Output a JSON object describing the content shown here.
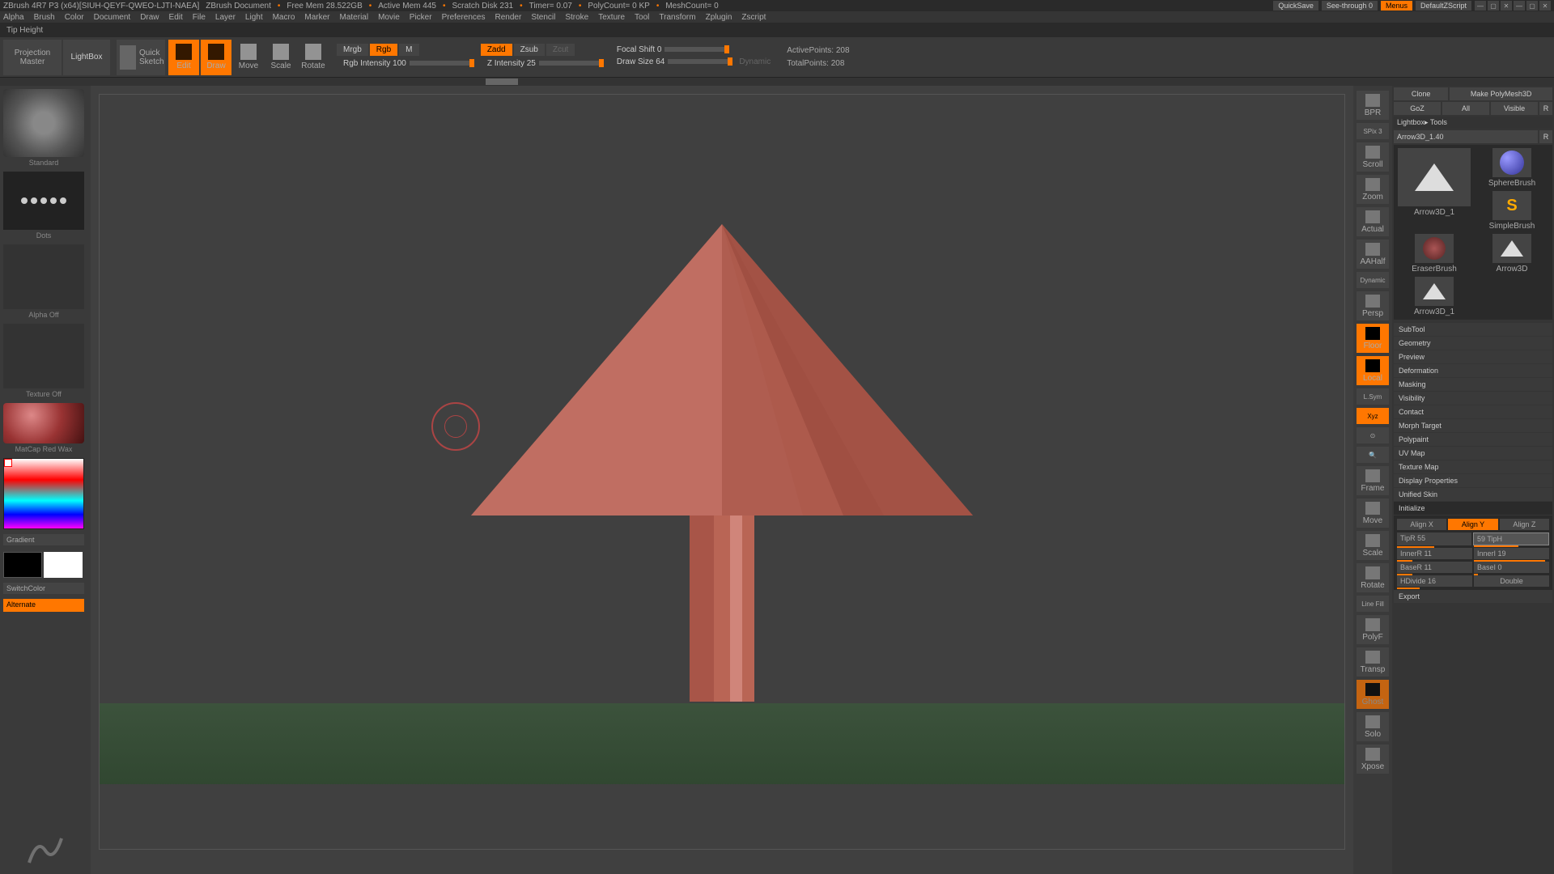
{
  "titlebar": {
    "app": "ZBrush 4R7 P3 (x64)[SIUH-QEYF-QWEO-LJTI-NAEA]",
    "doc": "ZBrush Document",
    "freemem": "Free Mem 28.522GB",
    "activemem": "Active Mem 445",
    "scratch": "Scratch Disk 231",
    "timer": "Timer= 0.07",
    "polycount": "PolyCount= 0 KP",
    "meshcount": "MeshCount= 0",
    "quicksave": "QuickSave",
    "seethrough": "See-through  0",
    "menus": "Menus",
    "script": "DefaultZScript"
  },
  "menu": [
    "Alpha",
    "Brush",
    "Color",
    "Document",
    "Draw",
    "Edit",
    "File",
    "Layer",
    "Light",
    "Macro",
    "Marker",
    "Material",
    "Movie",
    "Picker",
    "Preferences",
    "Render",
    "Stencil",
    "Stroke",
    "Texture",
    "Tool",
    "Transform",
    "Zplugin",
    "Zscript"
  ],
  "statusline": "Tip Height",
  "toolbar": {
    "projmaster1": "Projection",
    "projmaster2": "Master",
    "lightbox": "LightBox",
    "quick": "Quick",
    "sketch": "Sketch",
    "edit": "Edit",
    "draw": "Draw",
    "move": "Move",
    "scale": "Scale",
    "rotate": "Rotate",
    "mrgb": "Mrgb",
    "rgb": "Rgb",
    "m": "M",
    "rgbint": "Rgb Intensity 100",
    "zadd": "Zadd",
    "zsub": "Zsub",
    "zcut": "Zcut",
    "zint": "Z Intensity 25",
    "focal": "Focal Shift 0",
    "drawsize": "Draw Size 64",
    "dynamic": "Dynamic",
    "active": "ActivePoints: 208",
    "total": "TotalPoints: 208"
  },
  "left": {
    "brush": "Standard",
    "stroke": "Dots",
    "alpha": "Alpha Off",
    "texture": "Texture Off",
    "material": "MatCap Red Wax",
    "gradient": "Gradient",
    "switch": "SwitchColor",
    "alternate": "Alternate"
  },
  "rside": {
    "bpr": "BPR",
    "spix": "SPix 3",
    "scroll": "Scroll",
    "zoom": "Zoom",
    "actual": "Actual",
    "aahalf": "AAHalf",
    "persp": "Persp",
    "floor": "Floor",
    "local": "Local",
    "lsym": "L.Sym",
    "xyz": "Xyz",
    "frame": "Frame",
    "move": "Move",
    "scale": "Scale",
    "rotate": "Rotate",
    "linefill": "Line Fill",
    "polyf": "PolyF",
    "transp": "Transp",
    "ghost": "Ghost",
    "solo": "Solo",
    "xpose": "Xpose",
    "dynamic": "Dynamic"
  },
  "rpanel": {
    "clone": "Clone",
    "makepm": "Make PolyMesh3D",
    "goz": "GoZ",
    "all": "All",
    "visible": "Visible",
    "r": "R",
    "lbtools": "Lightbox▸ Tools",
    "toolname": "Arrow3D_1.40",
    "r2": "R",
    "tools": [
      "Arrow3D_1",
      "SphereBrush",
      "SimpleBrush",
      "EraserBrush",
      "Arrow3D",
      "Arrow3D_1"
    ],
    "sections": [
      "SubTool",
      "Geometry",
      "Preview",
      "Deformation",
      "Masking",
      "Visibility",
      "Contact",
      "Morph Target",
      "Polypaint",
      "UV Map",
      "Texture Map",
      "Display Properties",
      "Unified Skin",
      "Initialize"
    ],
    "alignx": "Align X",
    "aligny": "Align Y",
    "alignz": "Align Z",
    "tipr": "TipR 55",
    "tiph": "59 TipH",
    "innerr": "InnerR 11",
    "inneri": "InnerI 19",
    "baser": "BaseR 11",
    "basei": "BaseI 0",
    "hdiv": "HDivide 16",
    "double": "Double",
    "export": "Export"
  }
}
